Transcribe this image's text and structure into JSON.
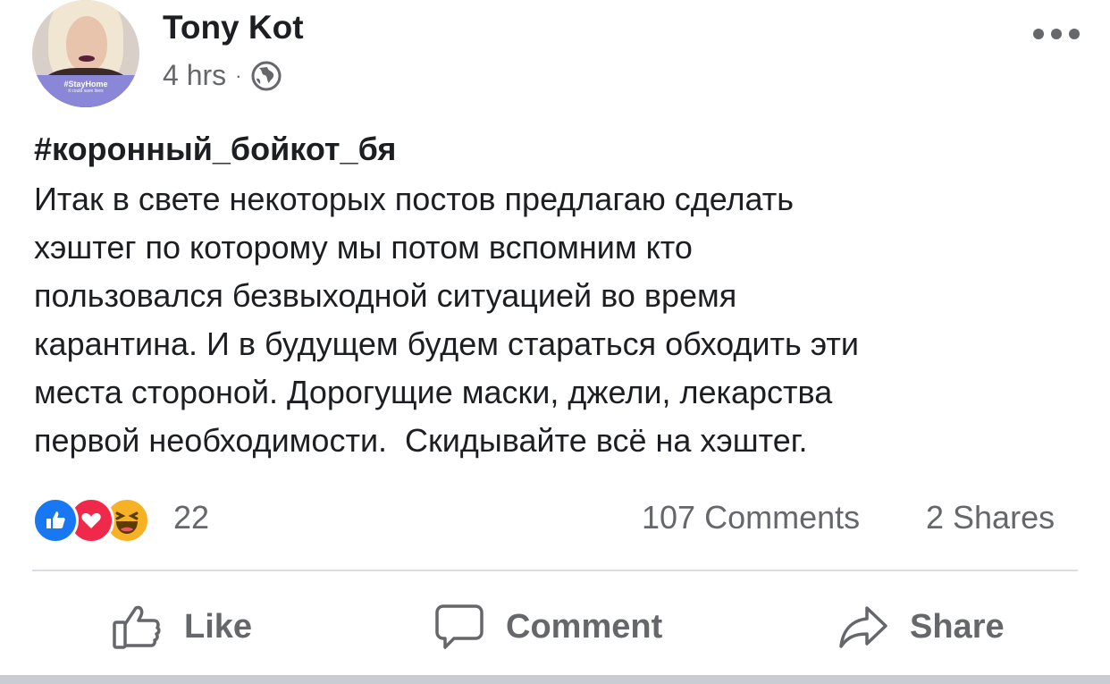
{
  "post": {
    "author": "Tony Kot",
    "time": "4 hrs",
    "separator": "·",
    "privacy_icon": "globe-icon",
    "avatar_frame_title": "#StayHome",
    "avatar_frame_subtitle": "it could save lives",
    "hashtag": "#коронный_бойкот_бя",
    "body_lines": [
      "Итак в свете некоторых постов предлагаю сделать",
      "хэштег по которому мы потом вспомним кто",
      "пользовался безвыходной ситуацией во время",
      "карантина. И в будущем будем стараться обходить эти",
      "места стороной. Дорогущие маски, джели, лекарства",
      "первой необходимости.  Скидывайте всё на хэштег."
    ]
  },
  "stats": {
    "reactions": [
      "like",
      "love",
      "haha"
    ],
    "reaction_count": "22",
    "comments": "107 Comments",
    "shares": "2 Shares"
  },
  "actions": {
    "like": "Like",
    "comment": "Comment",
    "share": "Share"
  },
  "colors": {
    "text": "#1c1e21",
    "secondary": "#65676b",
    "like_blue": "#1877f2",
    "love_red": "#f02849",
    "haha_yellow": "#f7b125",
    "divider": "#dadde1"
  }
}
